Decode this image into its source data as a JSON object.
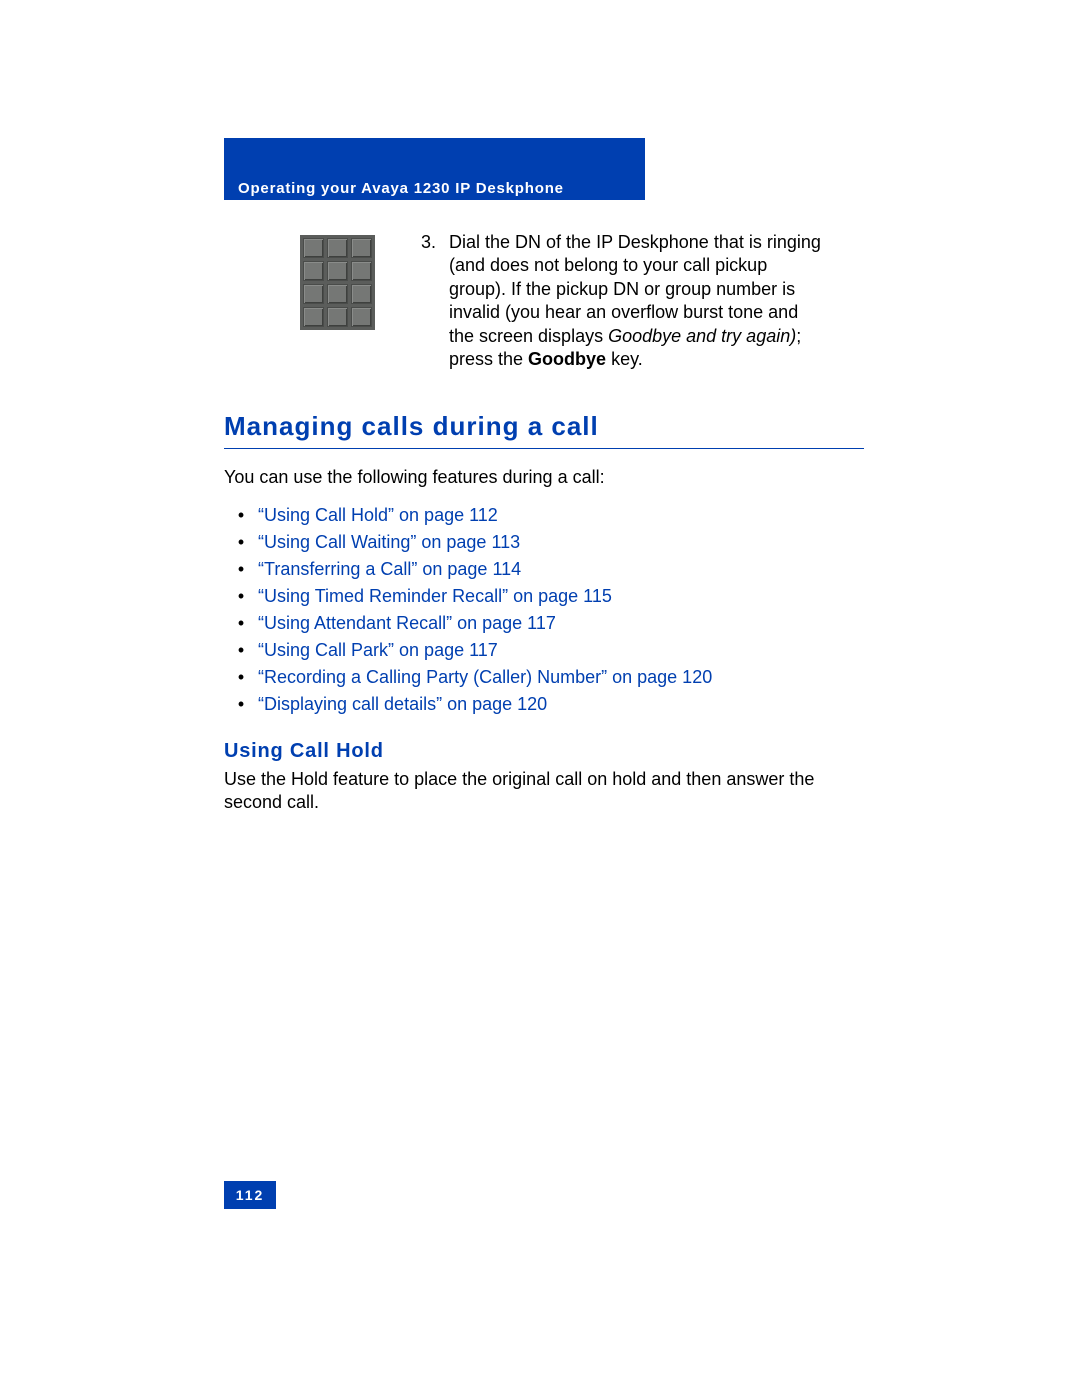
{
  "header": {
    "title": "Operating your Avaya 1230 IP Deskphone"
  },
  "step": {
    "number": "3.",
    "text_pre": "Dial the DN of the IP Deskphone that is ringing (and does not belong to your call pickup group). If the pickup DN or group number is invalid (you hear an overflow burst tone and the screen displays ",
    "italic": "Goodbye and try again)",
    "text_mid": "; press the ",
    "bold": "Goodbye",
    "text_post": " key."
  },
  "heading2": "Managing calls during a call",
  "intro": "You can use the following features during a call:",
  "links": [
    "“Using Call Hold” on page 112",
    "“Using Call Waiting” on page 113",
    "“Transferring a Call” on page 114",
    "“Using Timed Reminder Recall” on page 115",
    "“Using Attendant Recall” on page 117",
    "“Using Call Park” on page 117",
    "“Recording a Calling Party (Caller) Number” on page 120",
    "“Displaying call details” on page 120"
  ],
  "heading3": "Using Call Hold",
  "heading3_body": "Use the Hold feature to place the original call on hold and then answer the second call.",
  "page_number": "112"
}
